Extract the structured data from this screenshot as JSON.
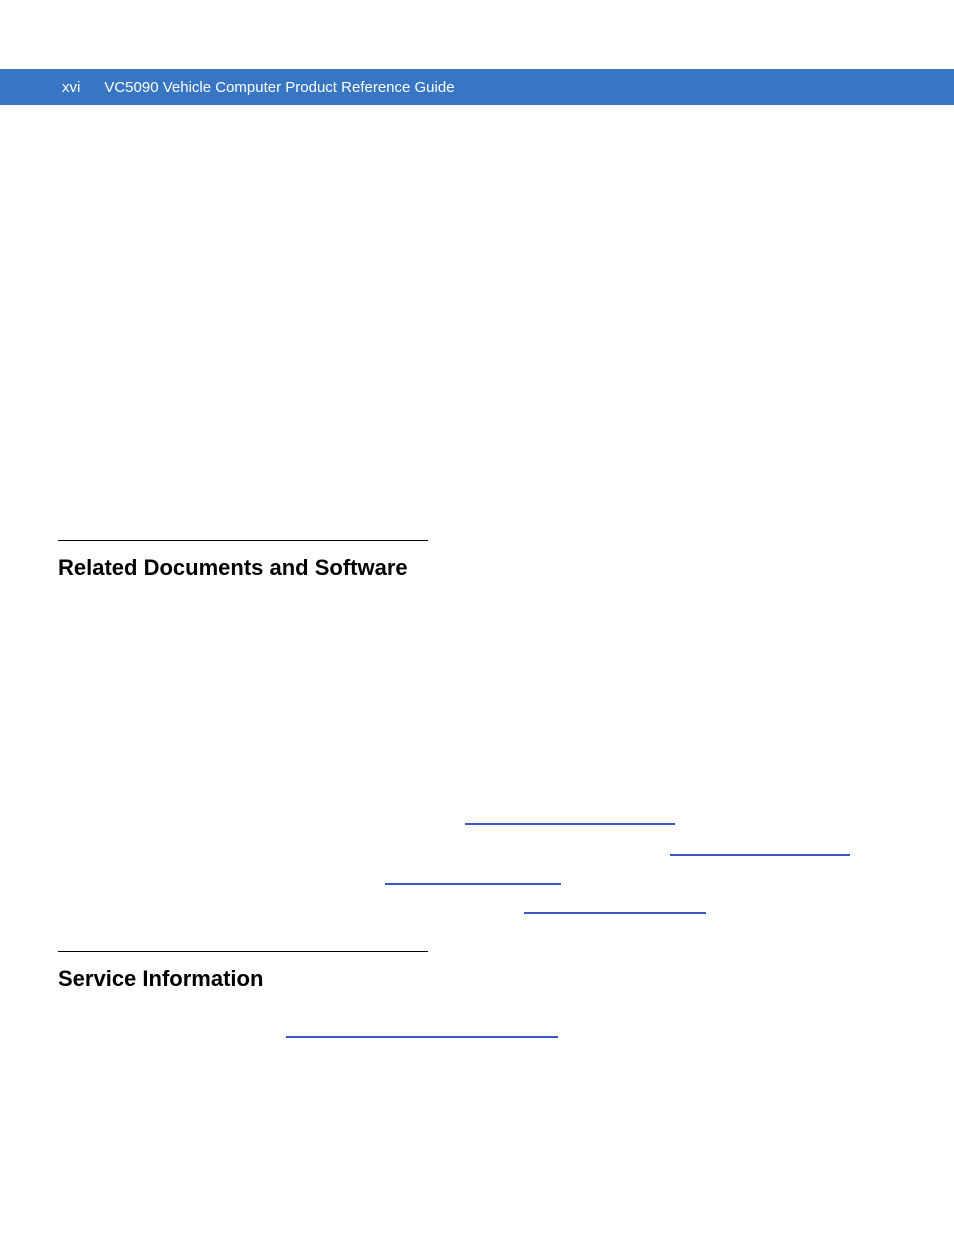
{
  "header": {
    "page_number": "xvi",
    "doc_title": "VC5090 Vehicle Computer Product Reference Guide"
  },
  "sections": {
    "related_docs": {
      "heading": "Related Documents and Software"
    },
    "service_info": {
      "heading": "Service Information"
    }
  }
}
